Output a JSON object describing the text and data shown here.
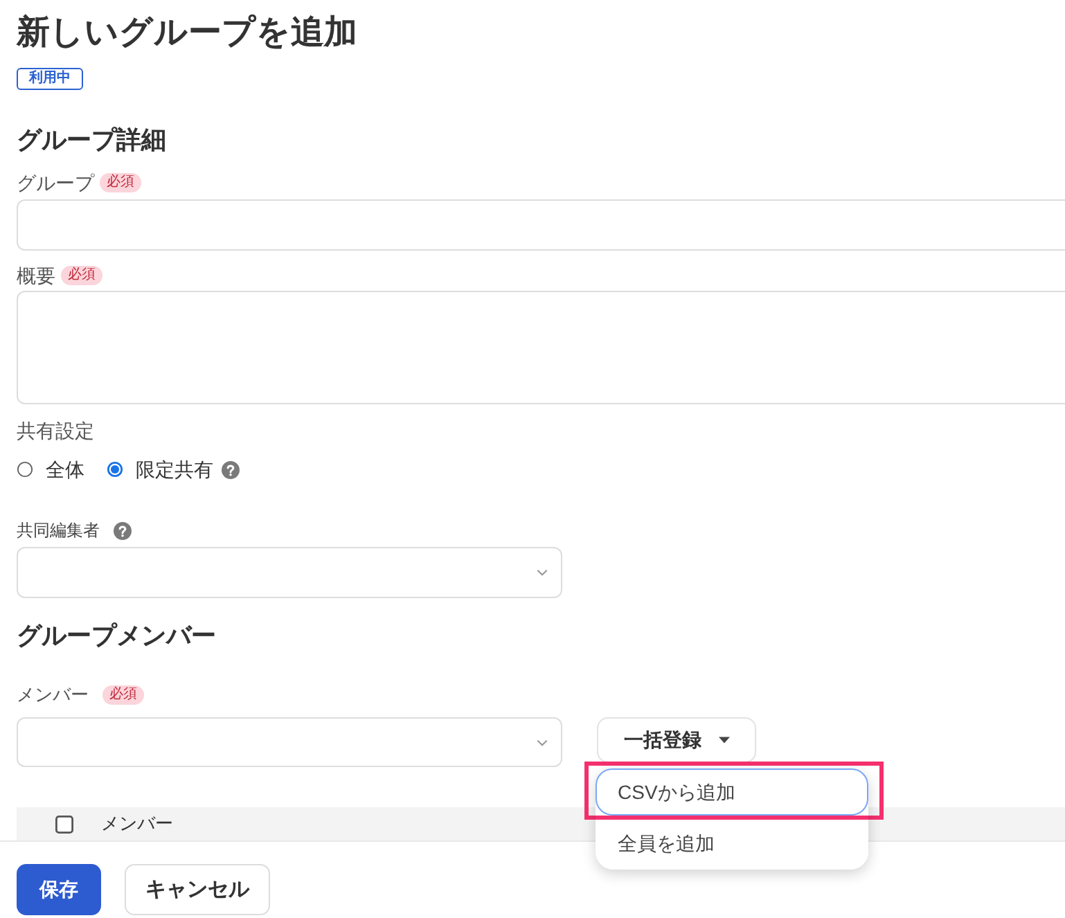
{
  "page": {
    "title": "新しいグループを追加",
    "status_badge": "利用中"
  },
  "group_details": {
    "heading": "グループ詳細",
    "fields": [
      {
        "kind": "input",
        "label": "グループ",
        "required_badge": "必須"
      },
      {
        "kind": "textarea",
        "label": "概要",
        "required_badge": "必須"
      }
    ]
  },
  "sharing": {
    "label": "共有設定",
    "options": [
      {
        "label": "全体",
        "selected": false,
        "help": false
      },
      {
        "label": "限定共有",
        "selected": true,
        "help": true
      }
    ]
  },
  "co_editors": {
    "label": "共同編集者",
    "help": true
  },
  "members": {
    "heading": "グループメンバー",
    "field": {
      "label": "メンバー",
      "required_badge": "必須"
    },
    "bulk_button": {
      "label": "一括登録",
      "expanded": true
    },
    "bulk_menu": [
      {
        "label": "CSVから追加",
        "focused": true,
        "highlighted": true
      },
      {
        "label": "全員を追加",
        "focused": false,
        "highlighted": false
      }
    ],
    "table": {
      "select_all_checked": false,
      "columns": [
        "メンバー"
      ]
    }
  },
  "footer": {
    "buttons": [
      {
        "label": "保存",
        "kind": "primary"
      },
      {
        "label": "キャンセル",
        "kind": "secondary"
      }
    ]
  }
}
